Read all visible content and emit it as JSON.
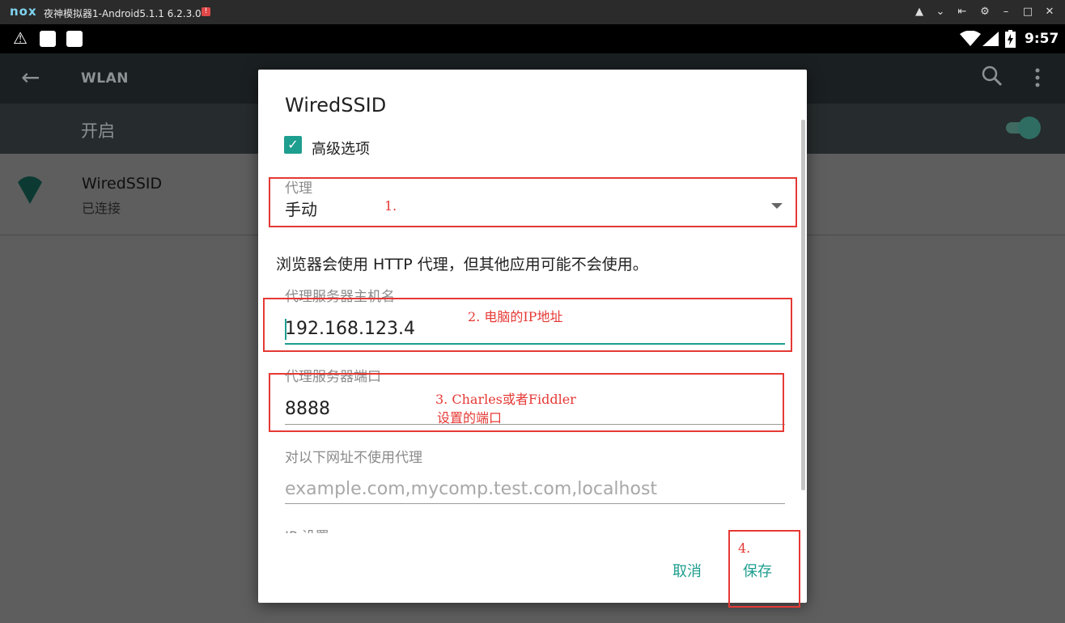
{
  "window": {
    "logo": "nox",
    "title": "夜神模拟器1-Android5.1.1 6.2.3.0",
    "badge": "!"
  },
  "status_bar": {
    "time": "9:57"
  },
  "app_bar": {
    "title": "WLAN"
  },
  "switch_row": {
    "label": "开启"
  },
  "network": {
    "name": "WiredSSID",
    "status": "已连接"
  },
  "dialog": {
    "title": "WiredSSID",
    "advanced_label": "高级选项",
    "proxy": {
      "label": "代理",
      "value": "手动"
    },
    "note": "浏览器会使用 HTTP 代理，但其他应用可能不会使用。",
    "host": {
      "label": "代理服务器主机名",
      "value": "192.168.123.4"
    },
    "port": {
      "label": "代理服务器端口",
      "value": "8888"
    },
    "bypass": {
      "label": "对以下网址不使用代理",
      "placeholder": "example.com,mycomp.test.com,localhost"
    },
    "ip_label": "IP 设置",
    "cancel": "取消",
    "save": "保存"
  },
  "annotations": {
    "a1": "1.",
    "a2": "2. 电脑的IP地址",
    "a3_line1": "3. Charles或者Fiddler",
    "a3_line2": "设置的端口",
    "a4": "4."
  },
  "colors": {
    "accent": "#1e9e8f",
    "annotation": "#e53935"
  }
}
